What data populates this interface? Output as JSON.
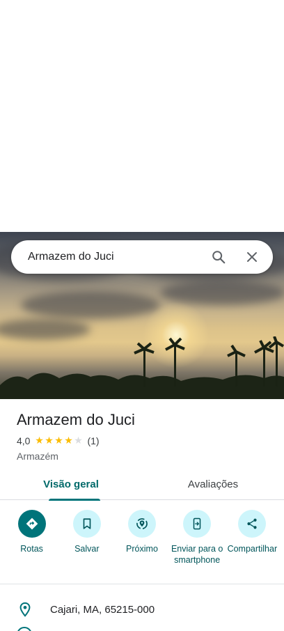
{
  "search": {
    "value": "Armazem do Juci"
  },
  "place": {
    "title": "Armazem do Juci",
    "rating": "4,0",
    "rating_value": 4,
    "rating_max": 5,
    "review_count": "(1)",
    "category": "Armazém"
  },
  "tabs": [
    {
      "label": "Visão geral",
      "active": true
    },
    {
      "label": "Avaliações",
      "active": false
    }
  ],
  "actions": [
    {
      "label": "Rotas",
      "icon": "directions-icon"
    },
    {
      "label": "Salvar",
      "icon": "bookmark-icon"
    },
    {
      "label": "Próximo",
      "icon": "nearby-icon"
    },
    {
      "label": "Enviar para o smartphone",
      "icon": "send-to-phone-icon"
    },
    {
      "label": "Compartilhar",
      "icon": "share-icon"
    }
  ],
  "address": {
    "text": "Cajari, MA, 65215-000"
  },
  "colors": {
    "accent": "#00747a",
    "accent_light": "#cdf5fb",
    "star_filled": "#fbbc04",
    "star_empty": "#dadce0"
  }
}
